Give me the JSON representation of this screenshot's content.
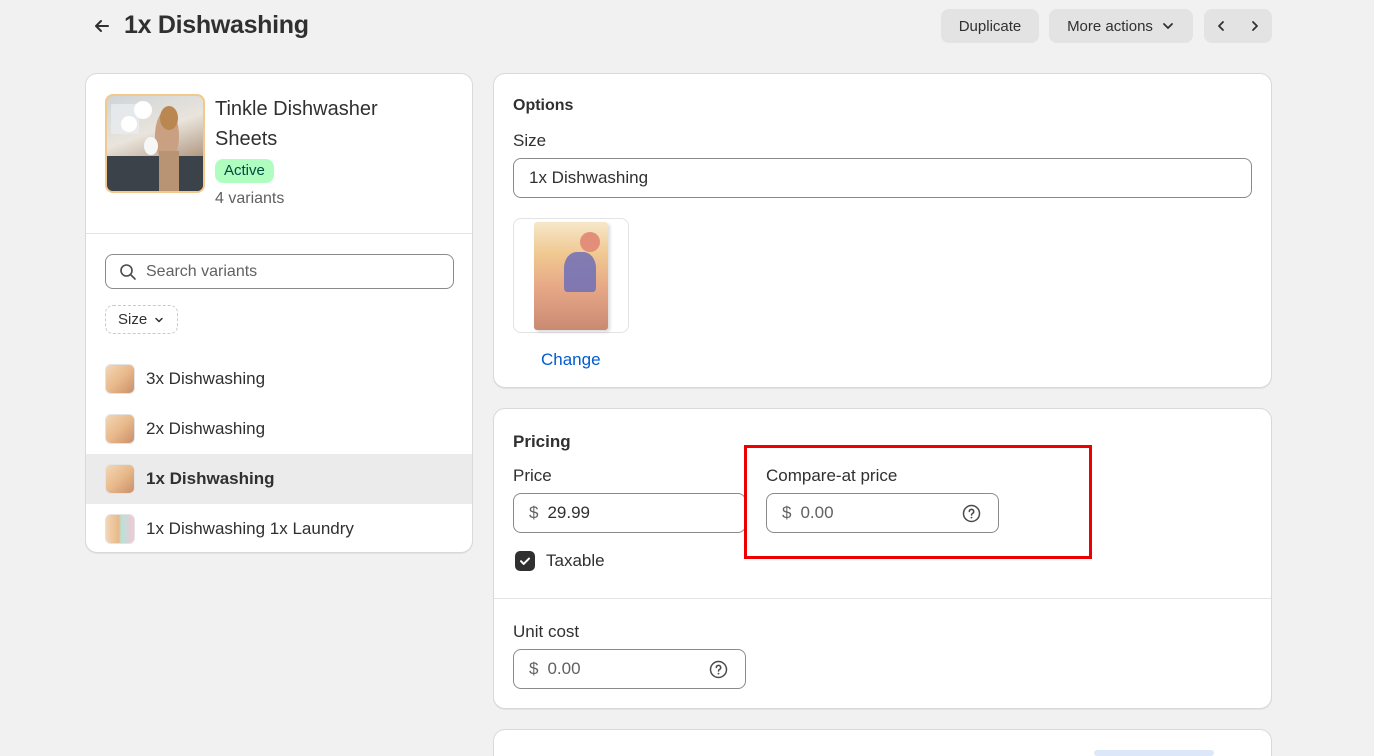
{
  "header": {
    "title": "1x Dishwashing",
    "duplicate_label": "Duplicate",
    "more_actions_label": "More actions"
  },
  "product": {
    "name": "Tinkle Dishwasher Sheets",
    "status": "Active",
    "variant_count": "4 variants"
  },
  "variants_panel": {
    "search_placeholder": "Search variants",
    "size_filter_label": "Size",
    "items": [
      {
        "label": "3x Dishwashing",
        "selected": false
      },
      {
        "label": "2x Dishwashing",
        "selected": false
      },
      {
        "label": "1x Dishwashing",
        "selected": true
      },
      {
        "label": "1x Dishwashing 1x Laundry",
        "selected": false
      }
    ]
  },
  "options": {
    "title": "Options",
    "size_label": "Size",
    "size_value": "1x Dishwashing",
    "change_label": "Change"
  },
  "pricing": {
    "title": "Pricing",
    "price_label": "Price",
    "currency": "$",
    "price_value": "29.99",
    "compare_label": "Compare-at price",
    "compare_placeholder": "0.00",
    "taxable_label": "Taxable",
    "taxable_checked": true,
    "unit_cost_label": "Unit cost",
    "unit_cost_placeholder": "0.00"
  },
  "colors": {
    "active_badge_bg": "#affebf",
    "link": "#005bd3",
    "highlight": "#ee0000"
  }
}
